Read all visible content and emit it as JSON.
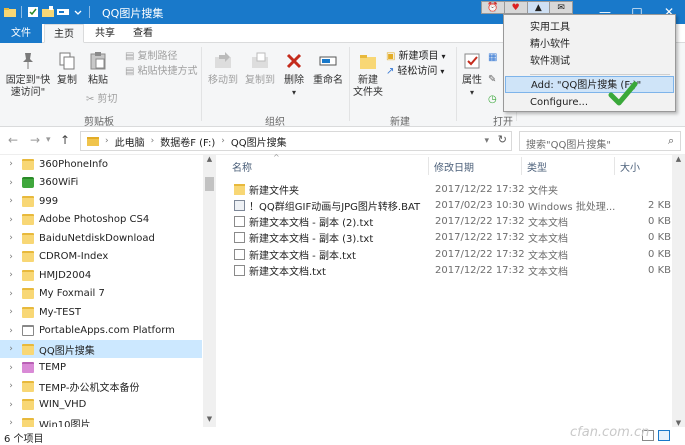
{
  "window": {
    "title": "QQ图片搜集",
    "tray_icons": [
      "clock-icon",
      "red-heart-icon",
      "eject-icon",
      "mail-icon"
    ],
    "buttons": [
      "—",
      "□",
      "✕"
    ]
  },
  "tabs": {
    "file": "文件",
    "home": "主页",
    "share": "共享",
    "view": "查看"
  },
  "ribbon": {
    "clipboard": {
      "group": "剪贴板",
      "pin": "固定到\"快",
      "pin2": "速访问\"",
      "copy": "复制",
      "paste": "粘贴",
      "cut": "剪切",
      "copy_path": "复制路径",
      "paste_shortcut": "粘贴快捷方式"
    },
    "organize": {
      "group": "组织",
      "move_to": "移动到",
      "copy_to": "复制到",
      "delete": "删除",
      "rename": "重命名"
    },
    "new": {
      "group": "新建",
      "new_folder": "新建",
      "new_folder2": "文件夹",
      "new_item": "新建项目",
      "easy_access": "轻松访问"
    },
    "open": {
      "group": "打开",
      "properties": "属性"
    }
  },
  "address": {
    "back": "←",
    "forward": "→",
    "up": "↑",
    "crumbs": [
      "此电脑",
      "数据卷F (F:)",
      "QQ图片搜集"
    ],
    "search_placeholder": "搜索\"QQ图片搜集\""
  },
  "nav_tree": [
    {
      "label": "360PhoneInfo",
      "icon": "folder"
    },
    {
      "label": "360WiFi",
      "icon": "wifi"
    },
    {
      "label": "999",
      "icon": "folder"
    },
    {
      "label": "Adobe Photoshop CS4",
      "icon": "folder"
    },
    {
      "label": "BaiduNetdiskDownload",
      "icon": "folder"
    },
    {
      "label": "CDROM-Index",
      "icon": "folder"
    },
    {
      "label": "HMJD2004",
      "icon": "folder"
    },
    {
      "label": "My Foxmail 7",
      "icon": "folder"
    },
    {
      "label": "My-TEST",
      "icon": "folder"
    },
    {
      "label": "PortableApps.com Platform",
      "icon": "file"
    },
    {
      "label": "QQ图片搜集",
      "icon": "folder",
      "selected": true
    },
    {
      "label": "TEMP",
      "icon": "pink"
    },
    {
      "label": "TEMP-办公机文本备份",
      "icon": "folder"
    },
    {
      "label": "WIN_VHD",
      "icon": "folder"
    },
    {
      "label": "Win10图片",
      "icon": "folder"
    }
  ],
  "columns": {
    "name": "名称",
    "date": "修改日期",
    "type": "类型",
    "size": "大小"
  },
  "files": [
    {
      "name": "新建文件夹",
      "date": "2017/12/22 17:32",
      "type": "文件夹",
      "size": "",
      "icon": "folder"
    },
    {
      "name": "！QQ群组GIF动画与JPG图片转移.BAT",
      "date": "2017/02/23 10:30",
      "type": "Windows 批处理...",
      "size": "2 KB",
      "icon": "bat"
    },
    {
      "name": "新建文本文档 - 副本 (2).txt",
      "date": "2017/12/22 17:32",
      "type": "文本文档",
      "size": "0 KB",
      "icon": "txt"
    },
    {
      "name": "新建文本文档 - 副本 (3).txt",
      "date": "2017/12/22 17:32",
      "type": "文本文档",
      "size": "0 KB",
      "icon": "txt"
    },
    {
      "name": "新建文本文档 - 副本.txt",
      "date": "2017/12/22 17:32",
      "type": "文本文档",
      "size": "0 KB",
      "icon": "txt"
    },
    {
      "name": "新建文本文档.txt",
      "date": "2017/12/22 17:32",
      "type": "文本文档",
      "size": "0 KB",
      "icon": "txt"
    }
  ],
  "status": {
    "count": "6 个项目"
  },
  "context_menu": {
    "items": [
      "实用工具",
      "精小软件",
      "软件测试"
    ],
    "add": "Add: \"QQ图片搜集 (F:)\"",
    "configure": "Configure..."
  },
  "watermark": "cfan.com.cn",
  "colors": {
    "accent": "#1979ca",
    "selected": "#cce8ff",
    "menu_highlight": "#cfe4f8",
    "check": "#3aa83a"
  }
}
